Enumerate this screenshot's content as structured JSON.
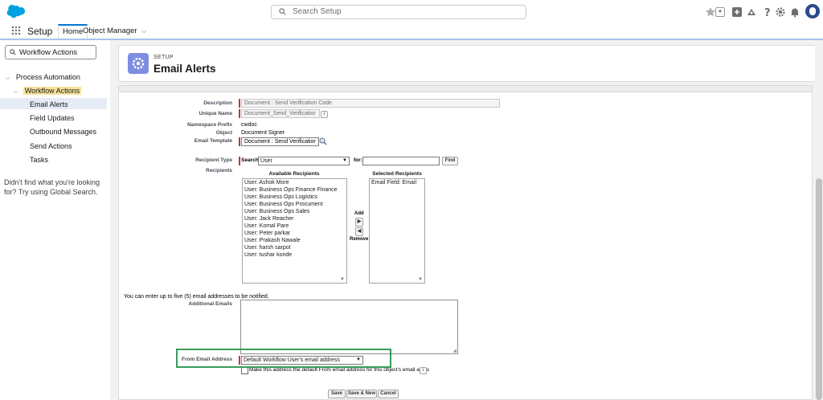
{
  "topbar": {
    "search_placeholder": "Search Setup",
    "icons": [
      "star-icon",
      "chevron-down-icon",
      "plus-icon",
      "help-trailhead-icon",
      "question-icon",
      "gear-icon",
      "bell-icon",
      "avatar"
    ]
  },
  "navbar": {
    "app_name": "Setup",
    "tabs": [
      {
        "label": "Home"
      },
      {
        "label": "Object Manager"
      }
    ]
  },
  "sidebar": {
    "quick_find_value": "Workflow Actions",
    "tree": {
      "process_automation": "Process Automation",
      "workflow_actions": "Workflow Actions",
      "items": [
        "Email Alerts",
        "Field Updates",
        "Outbound Messages",
        "Send Actions",
        "Tasks"
      ]
    },
    "help_text": "Didn't find what you're looking for? Try using Global Search."
  },
  "header": {
    "subtitle": "SETUP",
    "title": "Email Alerts"
  },
  "form": {
    "description": {
      "label": "Description",
      "value": "Document : Send Verification Code"
    },
    "unique_name": {
      "label": "Unique Name",
      "value": "Document_Send_Verificatior"
    },
    "namespace_prefix": {
      "label": "Namespace Prefix",
      "value": "cwdoc"
    },
    "object": {
      "label": "Object",
      "value": "Document Signer"
    },
    "email_template": {
      "label": "Email Template",
      "value": "Document : Send Verificatior"
    },
    "recipient_type": {
      "label": "Recipient Type",
      "search_label": "Search:",
      "selected": "User",
      "for_label": "for:",
      "find_button": "Find"
    },
    "recipients": {
      "label": "Recipients",
      "available_header": "Available Recipients",
      "selected_header": "Selected Recipients",
      "available": [
        "User: Ashok More",
        "User: Business Ops Finance Finance",
        "User: Business Ops Logistics",
        "User: Business Ops Procument",
        "User: Business Ops Sales",
        "User: Jack Reacher",
        "User: Komal Pare",
        "User: Peter parkar",
        "User: Prakash Nawale",
        "User: harsh sarpot",
        "User: tushar konde"
      ],
      "selected": [
        "Email Field: Email"
      ],
      "add_label": "Add",
      "remove_label": "Remove"
    },
    "additional_emails": {
      "note": "You can enter up to five (5) email addresses to be notified.",
      "label": "Additional Emails",
      "value": ""
    },
    "from_email": {
      "label": "From Email Address",
      "selected": "Default Workflow User's email address",
      "checkbox_label": "Make this address the default From email address for this object's email alerts"
    },
    "buttons": {
      "save": "Save",
      "save_new": "Save & New",
      "cancel": "Cancel"
    }
  },
  "colors": {
    "brand": "#0176d3",
    "header_icon": "#7f8de1",
    "highlight": "#3a9b5c",
    "required": "#c23934"
  }
}
